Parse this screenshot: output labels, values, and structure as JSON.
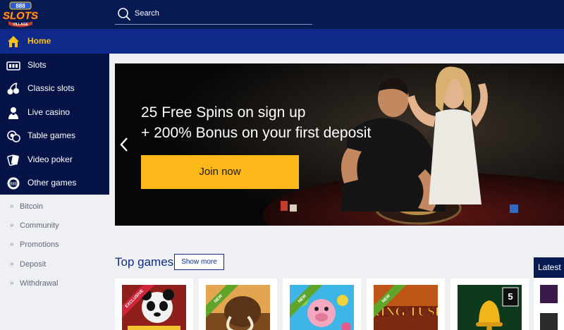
{
  "brand": {
    "logo_top": "888",
    "logo_main": "SLOTS",
    "logo_sub": "VILLAGE"
  },
  "search": {
    "placeholder": "Search"
  },
  "sidebar": {
    "home": "Home",
    "items": [
      {
        "label": "Slots",
        "icon": "slot-machine-icon"
      },
      {
        "label": "Classic slots",
        "icon": "cherries-icon"
      },
      {
        "label": "Live casino",
        "icon": "dealer-icon"
      },
      {
        "label": "Table games",
        "icon": "chips-icon"
      },
      {
        "label": "Video poker",
        "icon": "cards-icon"
      },
      {
        "label": "Other games",
        "icon": "chip-icon"
      }
    ],
    "links": [
      "Bitcoin",
      "Community",
      "Promotions",
      "Deposit",
      "Withdrawal"
    ]
  },
  "hero": {
    "line1": "25 Free Spins on sign up",
    "line2": "+ 200% Bonus on your first deposit",
    "cta": "Join now"
  },
  "top_games": {
    "title": "Top games",
    "show_more": "Show more",
    "games": [
      {
        "ribbon": "EXCLUSIVE",
        "ribbon_color": "#d0253a",
        "art_text": "Panda",
        "bg": "#b8332a"
      },
      {
        "ribbon": "NEW",
        "ribbon_color": "#5fa52a",
        "art_text": "",
        "bg": "#6b4a22"
      },
      {
        "ribbon": "NEW",
        "ribbon_color": "#5fa52a",
        "art_text": "",
        "bg": "#2aa3d8"
      },
      {
        "ribbon": "NEW",
        "ribbon_color": "#5fa52a",
        "art_text": "KING TUSK",
        "bg": "#c05518"
      },
      {
        "ribbon": "",
        "ribbon_color": "",
        "art_text": "5",
        "bg": "#0d3a1b"
      }
    ]
  },
  "latest": {
    "label": "Latest"
  },
  "colors": {
    "navy": "#081a52",
    "royal": "#0f2a8a",
    "gold": "#fcb719",
    "home_label": "#f6c215"
  }
}
